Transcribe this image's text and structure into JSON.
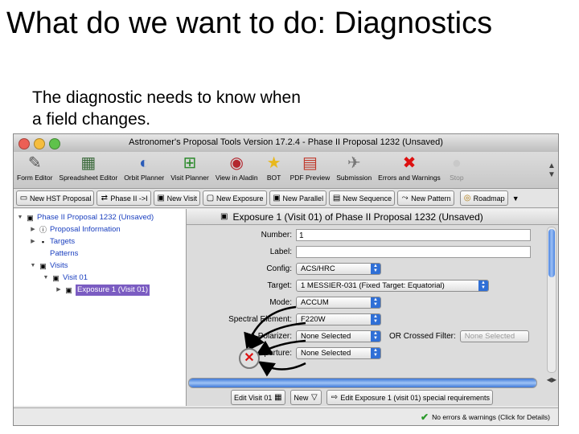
{
  "slide": {
    "title": "What do we want to do: Diagnostics",
    "body": "The diagnostic needs to know when a field changes."
  },
  "window": {
    "title": "Astronomer's Proposal Tools Version 17.2.4 - Phase II Proposal 1232 (Unsaved)",
    "traffic_lights": [
      "#ec5f55",
      "#f5bd3d",
      "#5fc24b"
    ]
  },
  "toolbar": {
    "items": [
      {
        "label": "Form Editor",
        "icon": "form-editor-icon",
        "glyph": "✎"
      },
      {
        "label": "Spreadsheet Editor",
        "icon": "spreadsheet-icon",
        "glyph": "▦"
      },
      {
        "label": "Orbit Planner",
        "icon": "orbit-planner-icon",
        "glyph": "◐"
      },
      {
        "label": "Visit Planner",
        "icon": "visit-planner-icon",
        "glyph": "⊞"
      },
      {
        "label": "View in Aladin",
        "icon": "aladin-icon",
        "glyph": "◉"
      },
      {
        "label": "BOT",
        "icon": "bot-star-icon",
        "glyph": "★"
      },
      {
        "label": "PDF Preview",
        "icon": "pdf-preview-icon",
        "glyph": "▤"
      },
      {
        "label": "Submission",
        "icon": "submission-icon",
        "glyph": "✈"
      },
      {
        "label": "Errors and Warnings",
        "icon": "errors-x-icon",
        "glyph": "✖"
      },
      {
        "label": "Stop",
        "icon": "stop-icon",
        "glyph": "●"
      }
    ]
  },
  "subbar": {
    "buttons": [
      {
        "label": "New HST Proposal",
        "glyph": "▭"
      },
      {
        "label": "Phase II ->I",
        "glyph": "⇄"
      },
      {
        "label": "New Visit",
        "glyph": "▣"
      },
      {
        "label": "New Exposure",
        "glyph": "▢"
      },
      {
        "label": "New Parallel",
        "glyph": "▣"
      },
      {
        "label": "New Sequence",
        "glyph": "▤"
      },
      {
        "label": "New Pattern",
        "glyph": "⤳"
      },
      {
        "label": "Roadmap",
        "glyph": "◎"
      }
    ],
    "end_icon": "▼"
  },
  "tree": {
    "items": [
      {
        "label": "Phase II Proposal 1232 (Unsaved)",
        "expanded": true,
        "glyph": "▣",
        "color": "#1a3fbf"
      },
      {
        "label": "Proposal Information",
        "expanded": false,
        "glyph": "ⓘ",
        "color": "#1a3fbf"
      },
      {
        "label": "Targets",
        "expanded": false,
        "glyph": "▪",
        "color": "#1a3fbf"
      },
      {
        "label": "Patterns",
        "expanded": false,
        "glyph": "",
        "color": "#1a3fbf"
      },
      {
        "label": "Visits",
        "expanded": true,
        "glyph": "▣",
        "color": "#1a3fbf"
      },
      {
        "label": "Visit 01",
        "expanded": true,
        "glyph": "▣",
        "color": "#1a3fbf"
      },
      {
        "label": "Exposure 1 (Visit 01)",
        "expanded": false,
        "glyph": "▣",
        "color": "#ffffff"
      }
    ]
  },
  "editor": {
    "header": "Exposure 1 (Visit 01) of Phase II Proposal 1232 (Unsaved)",
    "number_label": "Number:",
    "number_value": "1",
    "label_label": "Label:",
    "label_value": "",
    "config_label": "Config:",
    "config_value": "ACS/HRC",
    "target_label": "Target:",
    "target_value": "1 MESSIER-031 (Fixed Target: Equatorial)",
    "mode_label": "Mode:",
    "mode_value": "ACCUM",
    "spectral_label": "Spectral Element:",
    "spectral_value": "F220W",
    "polarizer_label": "Polarizer:",
    "polarizer_value": "None Selected",
    "crossed_label": "OR Crossed Filter:",
    "crossed_value": "None Selected",
    "aperture_label": "Aperture:",
    "aperture_value": "None Selected",
    "bottom": {
      "edit_visit": "Edit Visit 01",
      "new": "New",
      "edit_special": "Edit Exposure 1 (visit 01) special requirements"
    }
  },
  "status": {
    "text": "No errors & warnings (Click for Details)"
  },
  "accent": {
    "selection": "#7b5cc2",
    "scroll_blue": "#3e78d8",
    "error_red": "#d11111"
  }
}
